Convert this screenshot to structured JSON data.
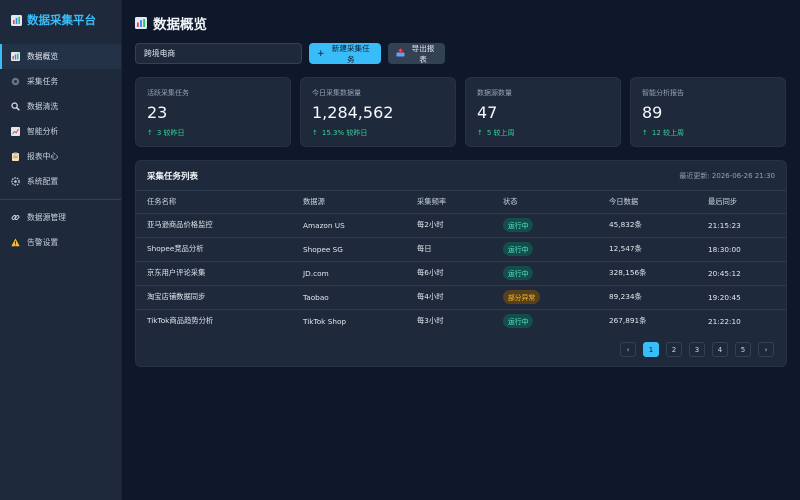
{
  "brand": {
    "title": "数据采集平台",
    "icon": "bar-chart-icon",
    "color": "#38bdf8"
  },
  "sidebar": {
    "items": [
      {
        "label": "数据概览",
        "icon": "chart-icon",
        "active": true
      },
      {
        "label": "采集任务",
        "icon": "gear-icon"
      },
      {
        "label": "数据清洗",
        "icon": "magnifier-icon"
      },
      {
        "label": "智能分析",
        "icon": "trend-icon"
      },
      {
        "label": "报表中心",
        "icon": "clipboard-icon"
      },
      {
        "label": "系统配置",
        "icon": "settings-icon"
      }
    ],
    "secondary": [
      {
        "label": "数据源管理",
        "icon": "link-icon"
      },
      {
        "label": "告警设置",
        "icon": "warning-icon"
      }
    ]
  },
  "header": {
    "title": "数据概览",
    "icon": "bar-chart-icon"
  },
  "toolbar": {
    "search_value": "跨境电商",
    "new_task_label": "新建采集任务",
    "export_label": "导出报表"
  },
  "cards": [
    {
      "label": "活跃采集任务",
      "value": "23",
      "trend": "3 较昨日"
    },
    {
      "label": "今日采集数据量",
      "value": "1,284,562",
      "trend": "15.3% 较昨日"
    },
    {
      "label": "数据源数量",
      "value": "47",
      "trend": "5 较上周"
    },
    {
      "label": "智能分析报告",
      "value": "89",
      "trend": "12 较上周"
    }
  ],
  "table": {
    "title": "采集任务列表",
    "updated": "最近更新: 2026-06-26 21:30",
    "columns": [
      "任务名称",
      "数据源",
      "采集频率",
      "状态",
      "今日数据",
      "最后同步"
    ],
    "rows": [
      {
        "name": "亚马逊商品价格监控",
        "source": "Amazon US",
        "freq": "每2小时",
        "status": "运行中",
        "status_type": "ok",
        "today": "45,832条",
        "sync": "21:15:23"
      },
      {
        "name": "Shopee竞品分析",
        "source": "Shopee SG",
        "freq": "每日",
        "status": "运行中",
        "status_type": "ok",
        "today": "12,547条",
        "sync": "18:30:00"
      },
      {
        "name": "京东用户评论采集",
        "source": "JD.com",
        "freq": "每6小时",
        "status": "运行中",
        "status_type": "ok",
        "today": "328,156条",
        "sync": "20:45:12"
      },
      {
        "name": "淘宝店铺数据同步",
        "source": "Taobao",
        "freq": "每4小时",
        "status": "部分异常",
        "status_type": "warn",
        "today": "89,234条",
        "sync": "19:20:45"
      },
      {
        "name": "TikTok商品趋势分析",
        "source": "TikTok Shop",
        "freq": "每3小时",
        "status": "运行中",
        "status_type": "ok",
        "today": "267,891条",
        "sync": "21:22:10"
      }
    ]
  },
  "pagination": {
    "prev": "‹",
    "pages": [
      "1",
      "2",
      "3",
      "4",
      "5"
    ],
    "current": "1",
    "next": "›"
  },
  "colors": {
    "accent": "#38bdf8",
    "positive": "#34d399",
    "warning": "#fbbf24",
    "bg": "#0f172a",
    "panel": "#1e293b"
  }
}
